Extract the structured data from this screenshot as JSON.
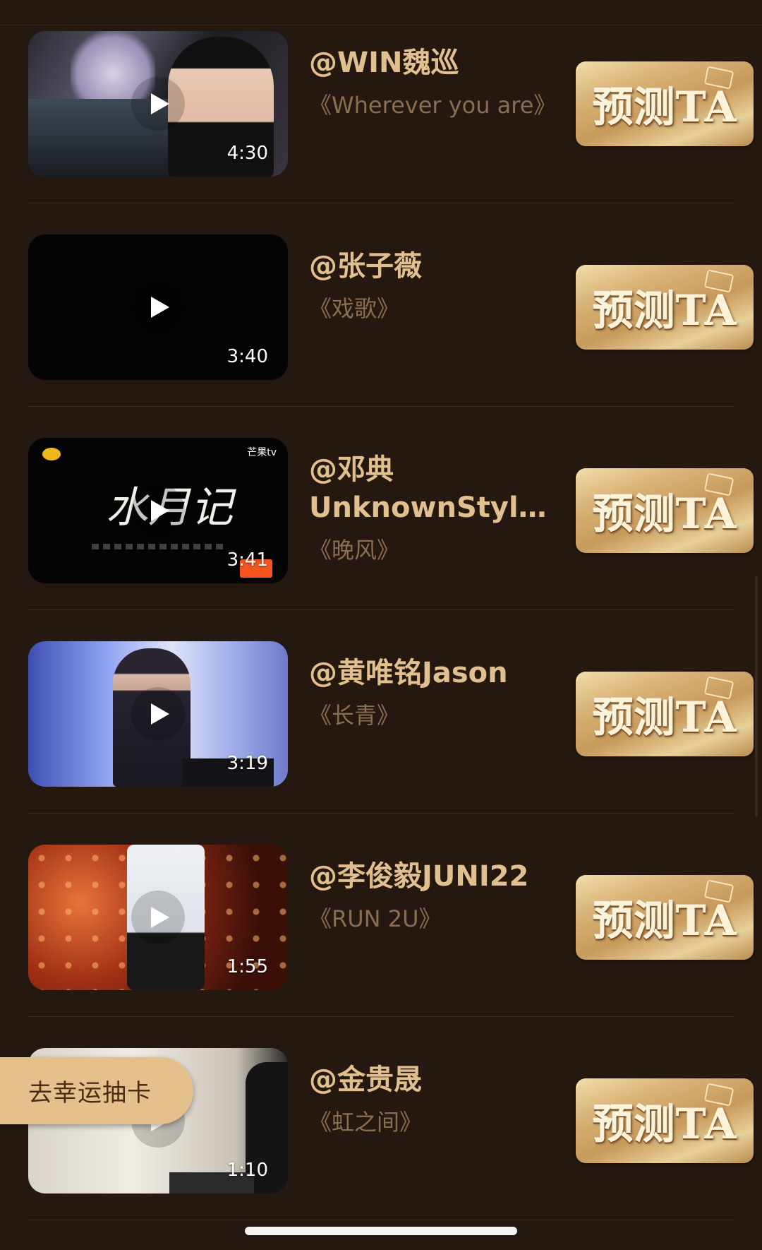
{
  "entries": [
    {
      "name": "@WIN魏巡",
      "song": "《Wherever you are》",
      "duration": "4:30"
    },
    {
      "name": "@张子薇",
      "song": "《戏歌》",
      "duration": "3:40"
    },
    {
      "name": "@邓典UnknownStyle...",
      "song": "《晚风》",
      "duration": "3:41"
    },
    {
      "name": "@黄唯铭Jason",
      "song": "《长青》",
      "duration": "3:19"
    },
    {
      "name": "@李俊毅JUNI22",
      "song": "《RUN 2U》",
      "duration": "1:55"
    },
    {
      "name": "@金贵晟",
      "song": "《虹之间》",
      "duration": "1:10"
    }
  ],
  "predict_label": "预测TA",
  "lucky_draw_label": "去幸运抽卡",
  "thumb_texts": {
    "entry3_title": "水月记",
    "entry3_channel": "芒果tv"
  },
  "colors": {
    "background": "#241810",
    "name_text": "#e2bf8f",
    "song_text": "#8a6e52",
    "button_gold": "#d9b277",
    "pill": "#e6c08c"
  },
  "icons": [
    "play-icon",
    "predict-badge-icon"
  ]
}
